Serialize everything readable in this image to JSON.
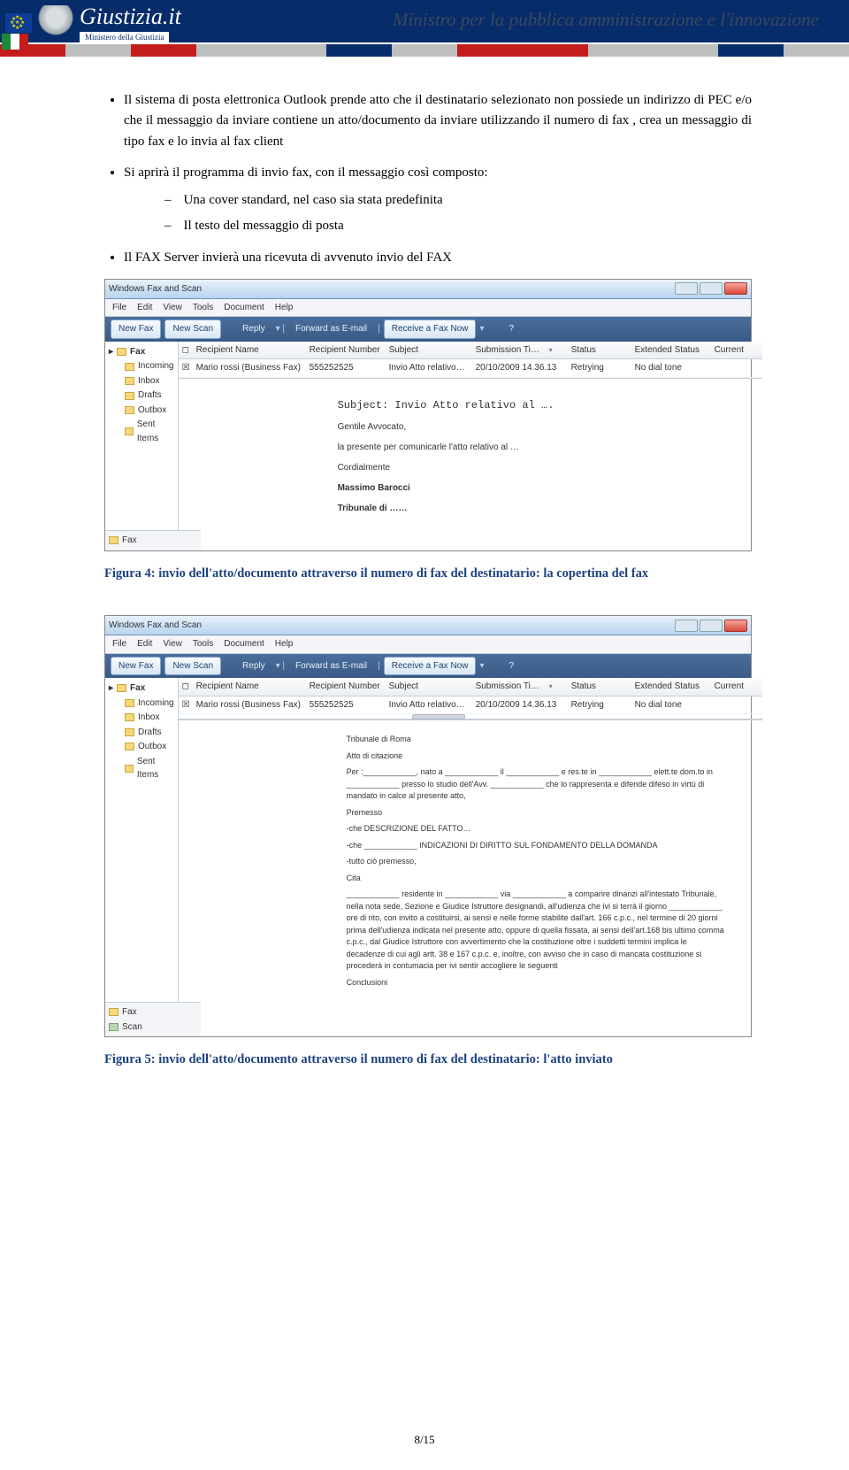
{
  "header": {
    "site_title": "Giustizia.it",
    "site_subtitle": "Ministero della Giustizia",
    "minister_line": "Ministro per la pubblica amministrazione e l'innovazione"
  },
  "stripe_colors": [
    "#c41c1c",
    "#bdbfbf",
    "#c41c1c",
    "#bdbfbf",
    "#bdbfbf",
    "#072c6a",
    "#bdbfbf",
    "#c41c1c",
    "#c41c1c",
    "#bdbfbf",
    "#bdbfbf",
    "#072c6a",
    "#bdbfbf"
  ],
  "it_flag": [
    "#1b8b3a",
    "#ffffff",
    "#c41c1c"
  ],
  "bullets": {
    "b1": "Il sistema di posta elettronica Outlook prende atto che il destinatario selezionato non possiede un indirizzo di PEC e/o che il messaggio da inviare contiene un atto/documento da inviare utilizzando il numero di fax , crea un messaggio di tipo fax e lo invia al fax client",
    "b2": "Si aprirà il programma di invio fax, con il messaggio così composto:",
    "b2a": "Una cover standard, nel caso sia stata predefinita",
    "b2b": "Il testo del messaggio di posta",
    "b3": "Il FAX Server invierà una ricevuta di avvenuto invio del FAX"
  },
  "window": {
    "title": "Windows Fax and Scan",
    "menu": [
      "File",
      "Edit",
      "View",
      "Tools",
      "Document",
      "Help"
    ],
    "toolbar": {
      "new_fax": "New Fax",
      "new_scan": "New Scan",
      "reply": "Reply",
      "forward": "Forward as E-mail",
      "receive": "Receive a Fax Now",
      "help": "?"
    },
    "tree": {
      "root": "Fax",
      "items": [
        "Incoming",
        "Inbox",
        "Drafts",
        "Outbox",
        "Sent Items"
      ]
    },
    "columns": [
      "",
      "Recipient Name",
      "Recipient Number",
      "Subject",
      "Submission Ti…",
      "Status",
      "Extended Status",
      "Current"
    ],
    "row": {
      "recipient_name": "Mario rossi (Business Fax)",
      "recipient_number": "555252525",
      "subject": "Invio Atto relativo…",
      "submission": "20/10/2009 14.36.13",
      "status": "Retrying",
      "ext_status": "No dial tone"
    },
    "foot_tabs": {
      "fax": "Fax",
      "scan": "Scan"
    }
  },
  "preview1": {
    "subject": "Subject: Invio Atto relativo al ….",
    "line1": "Gentile Avvocato,",
    "line2": "la presente per comunicarle l'atto relativo al …",
    "line3": "Cordialmente",
    "line4": "Massimo Barocci",
    "line5": "Tribunale di ……"
  },
  "caption1": "Figura 4: invio dell'atto/documento attraverso il numero di fax del destinatario: la copertina del fax",
  "preview2": {
    "p1": "Tribunale di Roma",
    "p2": "Atto di citazione",
    "p3": "Per :____________, nato a ____________ il ____________ e res.te in ____________ elett.te dom.to in ____________ presso lo studio dell'Avv. ____________ che lo rappresenta e difende difeso in virtù di mandato in calce al presente atto,",
    "p4": "Premesso",
    "p5": "-che DESCRIZIONE DEL FATTO…",
    "p6": "-che ____________ INDICAZIONI DI DIRITTO SUL FONDAMENTO DELLA DOMANDA",
    "p7": "-tutto ciò premesso,",
    "p8": "Cita",
    "p9": "____________ residente in ____________ via ____________ a comparire dinanzi all'intestato Tribunale, nella nota sede, Sezione e Giudice Istruttore designandi, all'udienza che ivi si terrà il giorno ____________ ore di rito, con invito a costituirsi, ai sensi e nelle forme stabilite dall'art. 166 c.p.c., nel termine di 20 giorni prima dell'udienza indicata nel presente atto, oppure di quella fissata, ai sensi dell'art.168 bis ultimo comma c.p.c., dal Giudice Istruttore con avvertimento che la costituzione oltre i suddetti termini implica le decadenze di cui agli artt. 38 e 167 c.p.c. e, inoltre, con avviso che in caso di mancata costituzione si procederà in contumacia per ivi sentir accogliere le seguenti",
    "p10": "Conclusioni"
  },
  "caption2": "Figura 5: invio dell'atto/documento attraverso il numero di fax del destinatario: l'atto inviato",
  "page_number": "8/15"
}
